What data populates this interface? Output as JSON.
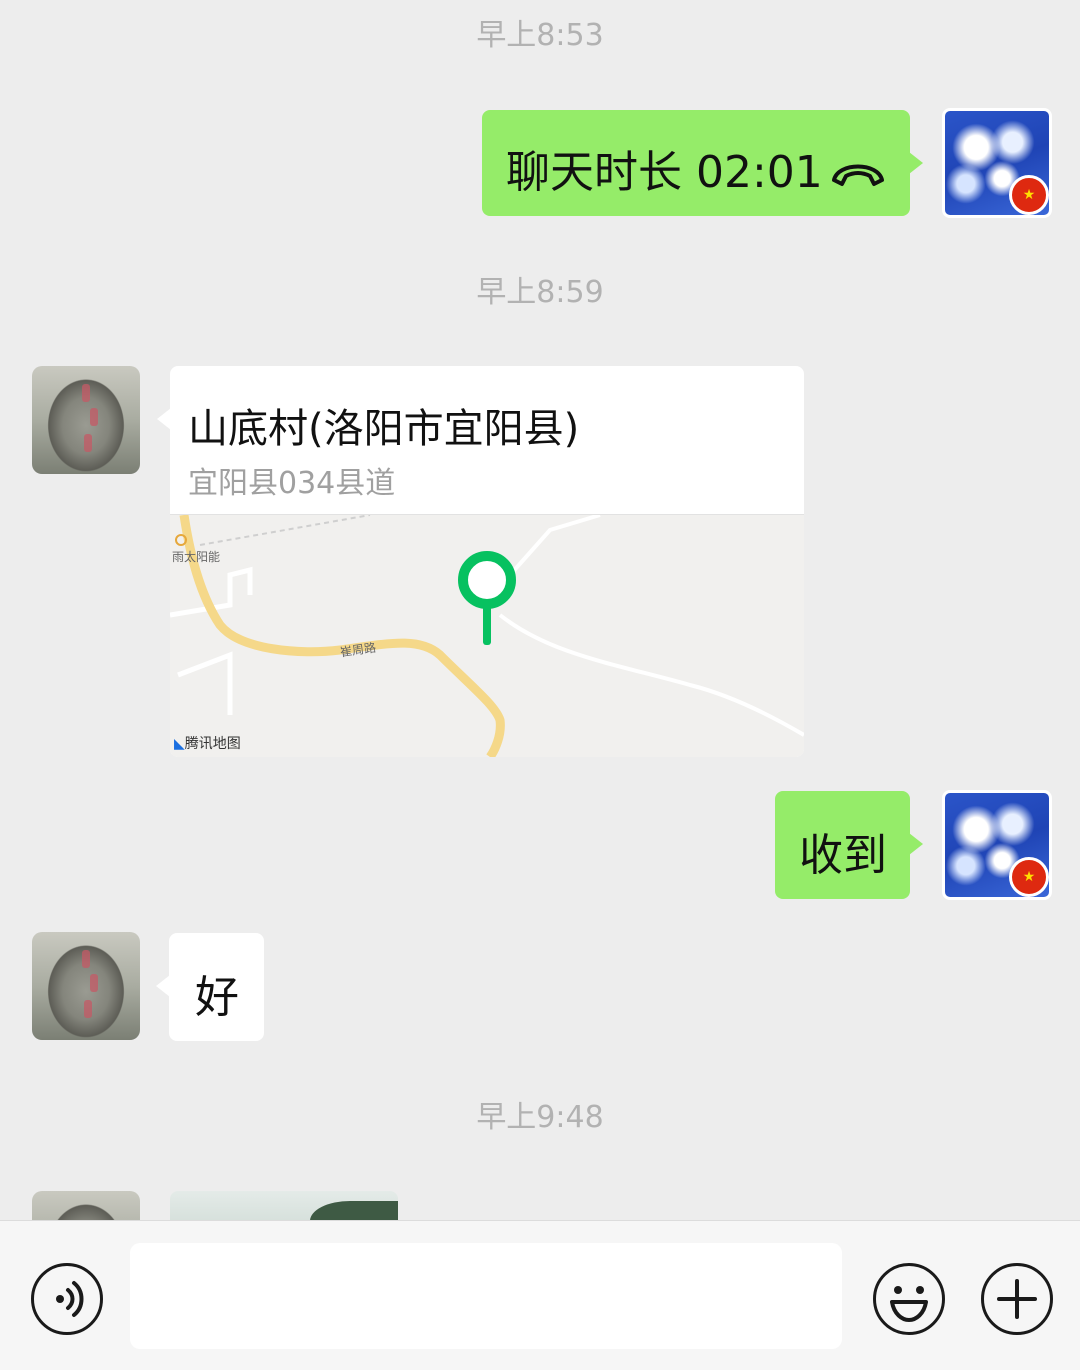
{
  "messages": {
    "time_1": "早上8:53",
    "call_text": "聊天时长 02:01",
    "time_2": "早上8:59",
    "location": {
      "title": "山底村(洛阳市宜阳县)",
      "address": "宜阳县034县道",
      "map_poi": "雨太阳能",
      "map_road": "崔周路",
      "map_brand": "腾讯地图"
    },
    "reply_received": "收到",
    "reply_ok": "好",
    "time_3": "早上9:48"
  },
  "icons": {
    "call": "phone-hangup-icon",
    "voice": "voice-icon",
    "emoji": "emoji-icon",
    "more": "plus-icon"
  },
  "colors": {
    "sent_bubble": "#95ec69",
    "received_bubble": "#ffffff",
    "map_pin": "#07c160",
    "background": "#ededed"
  }
}
